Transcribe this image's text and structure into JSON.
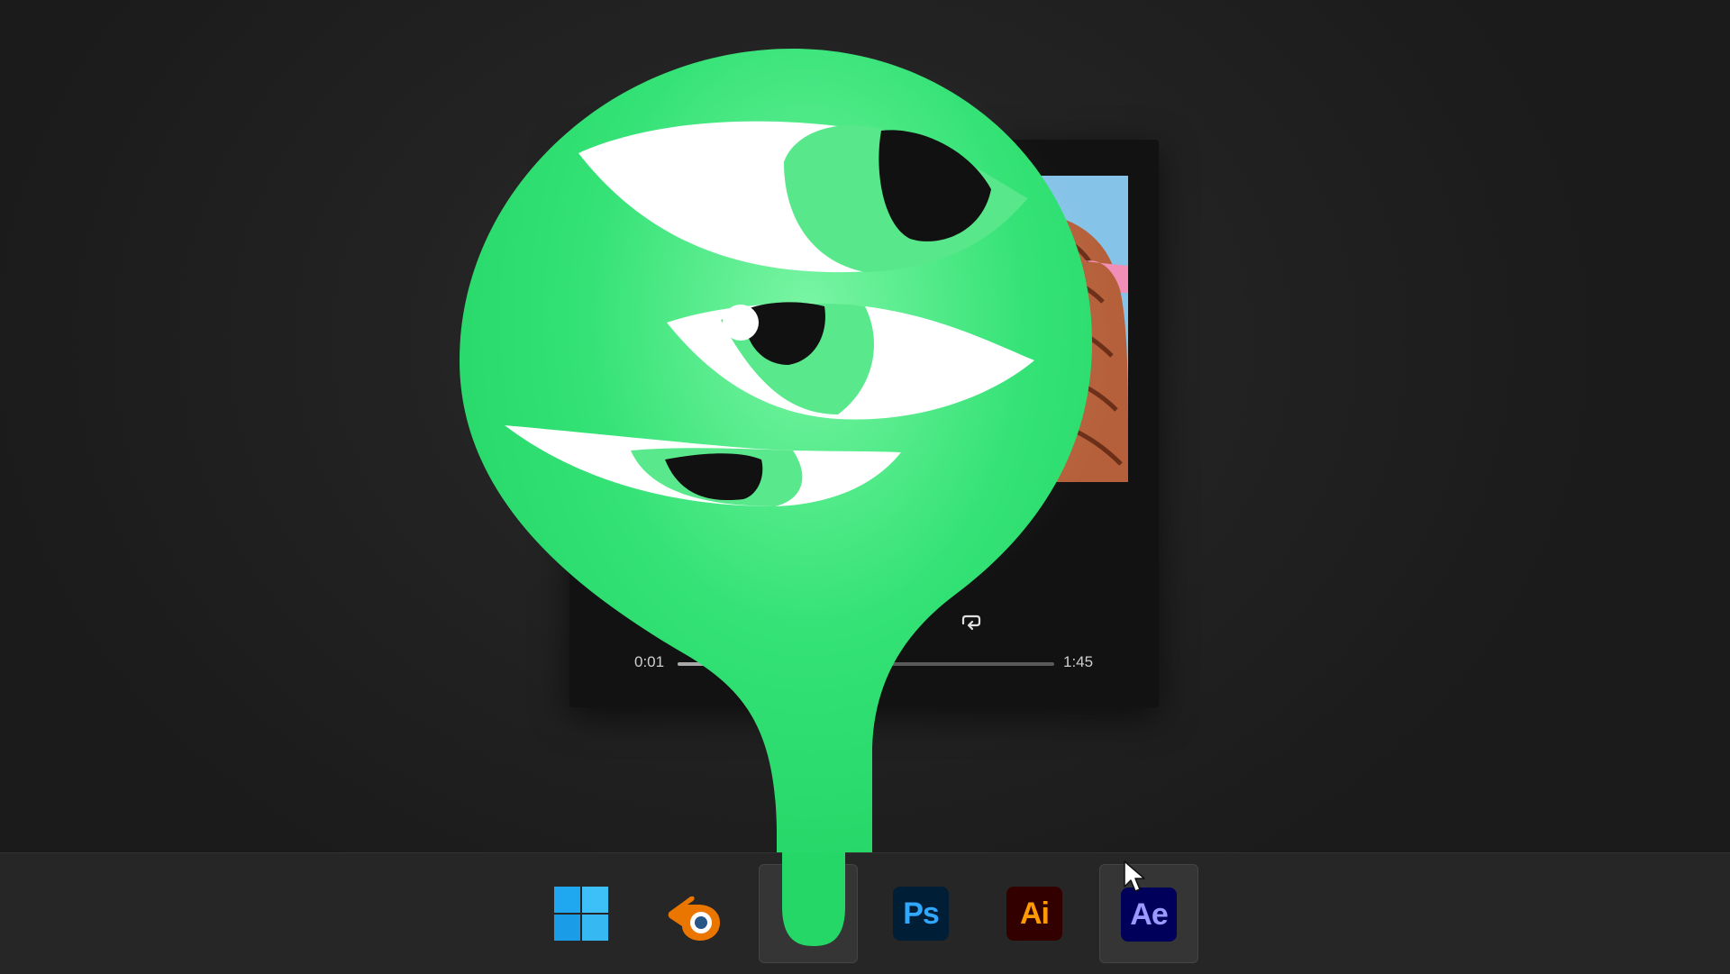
{
  "player": {
    "elapsed": "0:01",
    "total": "1:45",
    "progress_fraction": 0.32,
    "repeat_icon": "repeat-icon"
  },
  "mascot": {
    "icon": "green-three-eyed-blob",
    "color": "#2be06e"
  },
  "taskbar": {
    "apps": [
      {
        "name": "windows-start",
        "icon": "windows-logo-icon",
        "label": ""
      },
      {
        "name": "blender",
        "icon": "blender-icon",
        "label": ""
      },
      {
        "name": "active-app",
        "icon": "blob-app-icon",
        "label": ""
      },
      {
        "name": "photoshop",
        "icon": "photoshop-icon",
        "label": "Ps"
      },
      {
        "name": "illustrator",
        "icon": "illustrator-icon",
        "label": "Ai"
      },
      {
        "name": "after-effects",
        "icon": "after-effects-icon",
        "label": "Ae"
      }
    ]
  },
  "colors": {
    "ps_bg": "#001e36",
    "ps_fg": "#31a8ff",
    "ai_bg": "#330000",
    "ai_fg": "#ff9a00",
    "ae_bg": "#00005b",
    "ae_fg": "#9999ff",
    "blender_orange": "#ea7600",
    "windows_blue": "#1fa8f0"
  }
}
